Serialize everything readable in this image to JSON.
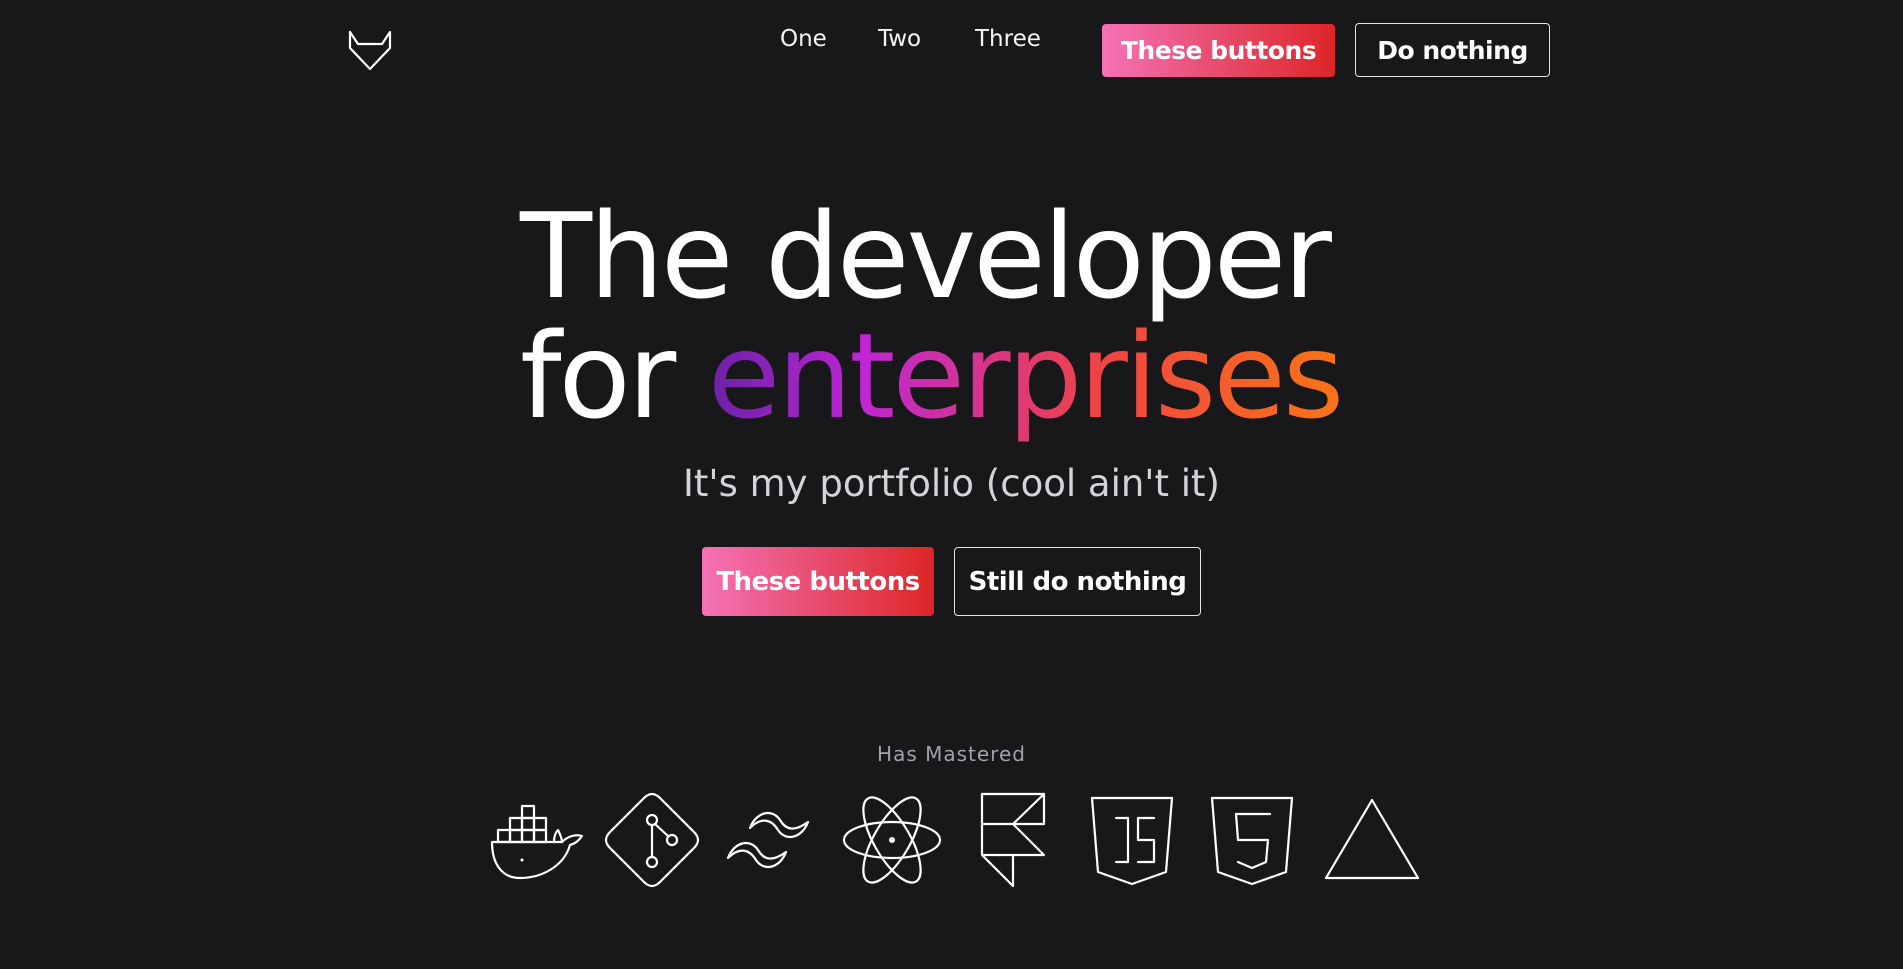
{
  "nav": {
    "logo_icon": "gitlab-icon",
    "links": [
      "One",
      "Two",
      "Three"
    ],
    "primary_button": "These buttons",
    "secondary_button": "Do nothing"
  },
  "hero": {
    "title_line1": "The developer",
    "title_line2_plain": "for ",
    "title_line2_accent": "enterprises",
    "subtitle": "It's my portfolio (cool ain't it)",
    "primary_button": "These buttons",
    "secondary_button": "Still do nothing"
  },
  "skills": {
    "heading": "Has Mastered",
    "icons": [
      "docker-icon",
      "git-icon",
      "tailwind-icon",
      "electron-icon",
      "framer-icon",
      "javascript-icon",
      "html5-icon",
      "vercel-icon"
    ]
  },
  "colors": {
    "background": "#18181b",
    "button_gradient_start": "#f472b6",
    "button_gradient_end": "#dc2626",
    "accent_gradient": [
      "#6b21a8",
      "#c026d3",
      "#ef4444",
      "#f97316"
    ]
  }
}
